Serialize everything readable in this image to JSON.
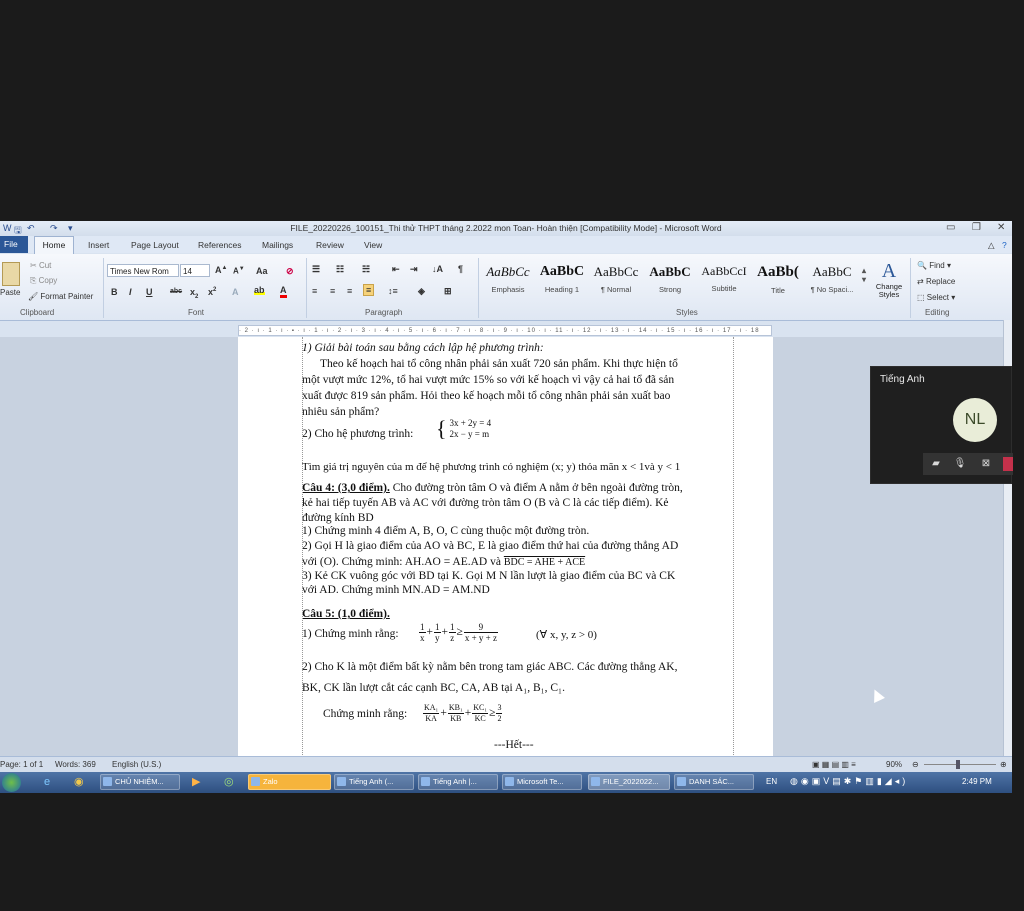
{
  "window": {
    "title": "FILE_20220226_100151_Thi thử THPT tháng 2.2022 mon Toan- Hoàn thiện [Compatibility Mode]  -  Microsoft Word"
  },
  "tabs": [
    "File",
    "Home",
    "Insert",
    "Page Layout",
    "References",
    "Mailings",
    "Review",
    "View"
  ],
  "ribbon": {
    "clipboard": {
      "paste": "Paste",
      "cut": "Cut",
      "copy": "Copy",
      "format_painter": "Format Painter",
      "label": "Clipboard"
    },
    "font": {
      "name": "Times New Rom",
      "size": "14",
      "label": "Font",
      "case": "Aa"
    },
    "paragraph": {
      "label": "Paragraph"
    },
    "styles": {
      "label": "Styles",
      "items": [
        {
          "preview": "AaBbCc",
          "name": "Emphasis"
        },
        {
          "preview": "AaBbC",
          "name": "Heading 1"
        },
        {
          "preview": "AaBbCc",
          "name": "¶ Normal"
        },
        {
          "preview": "AaBbC",
          "name": "Strong"
        },
        {
          "preview": "AaBbCcI",
          "name": "Subtitle"
        },
        {
          "preview": "AaBb(",
          "name": "Title"
        },
        {
          "preview": "AaBbC",
          "name": "¶ No Spaci..."
        }
      ],
      "change_styles": "Change Styles"
    },
    "editing": {
      "find": "Find",
      "replace": "Replace",
      "select": "Select",
      "label": "Editing"
    }
  },
  "ruler": "· 2 · ı · 1 · ı · 🞍 · ı · 1 · ı · 2 · ı · 3 · ı · 4 · ı · 5 · ı · 6 · ı · 7 · ı · 8 · ı · 9 · ı · 10 · ı · 11 · ı · 12 · ı · 13 · ı · 14 · ı · 15 · ı · 16 · ı · 17 · ı · 18",
  "document": {
    "l1": "1) Giải bài toán sau bằng cách lập hệ phương trình:",
    "l2": "Theo kế hoạch hai tổ công nhân phải sản xuất 720 sản phẩm. Khi thực hiện tổ",
    "l3": "một vượt mức 12%, tổ hai vượt mức 15%  so với kế hoạch vì vậy cả hai tổ đã sản",
    "l4": "xuất được 819 sản phẩm. Hỏi theo kế hoạch mỗi tổ công nhân phải sản xuất bao",
    "l5": "nhiêu sản phẩm?",
    "l6": "2) Cho hệ phương trình:",
    "sys1": "3x + 2y = 4",
    "sys2": "2x − y = m",
    "l7": "Tìm giá trị nguyên của m để hệ phương trình có nghiệm (x; y) thỏa mãn x < 1và y < 1",
    "q4_head": "Câu 4: (3,0 điểm).",
    "l8": " Cho đường tròn tâm O và điểm A nằm ở bên ngoài đường tròn,",
    "l9": "kẻ hai tiếp tuyến AB và AC với đường tròn tâm O (B và C là các tiếp điểm). Kẻ",
    "l10": "đường kính BD",
    "l11": "1) Chứng minh 4 điểm A, B, O, C cùng thuộc một đường tròn.",
    "l12": "2)  Gọi H là giao điểm của AO và BC, E là giao điểm thứ hai của đường thẳng AD",
    "l13a": "với (O).   Chứng minh: AH.AO = AE.AD và ",
    "l13b": "BDC = AHE + ACE",
    "l14": "3)  Kẻ CK vuông góc với  BD tại K. Gọi M N lần lượt là giao điểm của BC và CK",
    "l15": "với AD.  Chứng minh MN.AD = AM.ND",
    "q5_head": "Câu 5: (1,0 điểm).",
    "l16": "1) Chứng minh rằng:",
    "f1n": "1",
    "f1d": "x",
    "f2n": "1",
    "f2d": "y",
    "f3n": "1",
    "f3d": "z",
    "geq": "≥",
    "f4n": "9",
    "f4d": "x + y + z",
    "cond": "(∀ x, y, z > 0)",
    "l17": "2)  Cho K là một điểm bất kỳ nằm bên trong  tam giác ABC. Các đường thẳng AK,",
    "l18": "BK, CK lần lượt cắt  các cạnh BC, CA, AB tại A₁, B₁, C₁.",
    "l19": "Chứng minh rằng:",
    "g1n": "KA₁",
    "g1d": "KA",
    "g2n": "KB₁",
    "g2d": "KB",
    "g3n": "KC₁",
    "g3d": "KC",
    "g4n": "3",
    "g4d": "2",
    "end": "---Hết---"
  },
  "status": {
    "page": "Page: 1 of 1",
    "words": "Words: 369",
    "lang": "English (U.S.)",
    "zoom": "90%"
  },
  "taskbar": {
    "items": [
      "CHỦ NHIỆM...",
      "Zalo",
      "Tiếng Anh (...",
      "Tiếng Anh |...",
      "Microsoft Te...",
      "FILE_2022022...",
      "DANH SÁC..."
    ],
    "lang": "EN",
    "clock": "2:49 PM"
  },
  "meeting": {
    "name": "Tiếng Anh",
    "initials": "NL"
  }
}
